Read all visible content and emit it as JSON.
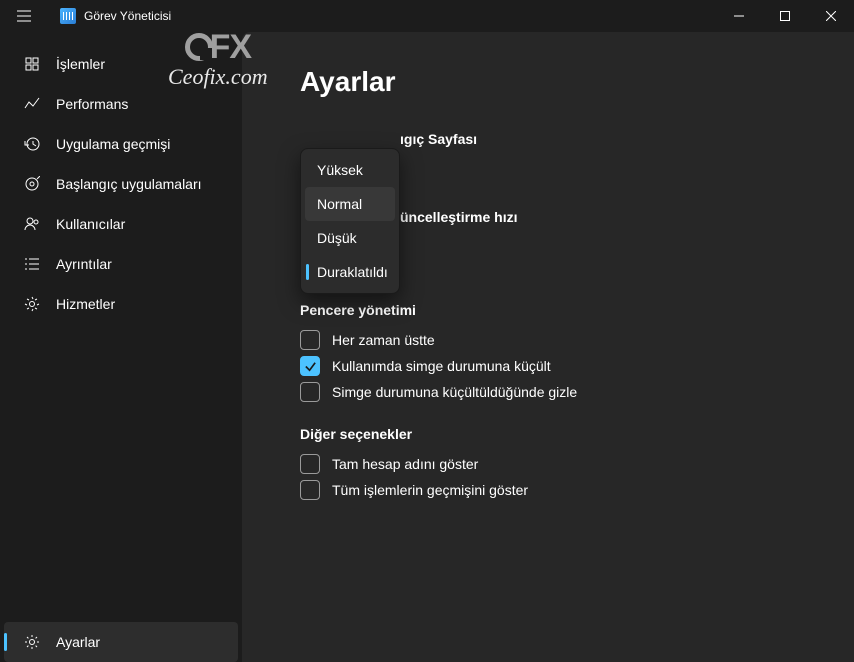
{
  "title": "Görev Yöneticisi",
  "watermark": {
    "logo_text": "FX",
    "site": "Ceofix.com"
  },
  "sidebar": {
    "items": [
      {
        "label": "İşlemler"
      },
      {
        "label": "Performans"
      },
      {
        "label": "Uygulama geçmişi"
      },
      {
        "label": "Başlangıç uygulamaları"
      },
      {
        "label": "Kullanıcılar"
      },
      {
        "label": "Ayrıntılar"
      },
      {
        "label": "Hizmetler"
      }
    ],
    "footer_label": "Ayarlar"
  },
  "page": {
    "title": "Ayarlar",
    "section1_partial": "ıgıç Sayfası",
    "section2_partial": "üncelleştirme hızı",
    "dropdown": {
      "items": [
        {
          "label": "Yüksek"
        },
        {
          "label": "Normal"
        },
        {
          "label": "Düşük"
        },
        {
          "label": "Duraklatıldı"
        }
      ]
    },
    "window_mgmt": {
      "title": "Pencere yönetimi",
      "opt_always_top": "Her zaman üstte",
      "opt_minimize_on_use": "Kullanımda simge durumuna küçült",
      "opt_hide_when_min": "Simge durumuna küçültüldüğünde gizle"
    },
    "other": {
      "title": "Diğer seçenekler",
      "opt_full_account": "Tam hesap adını göster",
      "opt_all_history": "Tüm işlemlerin geçmişini göster"
    }
  }
}
